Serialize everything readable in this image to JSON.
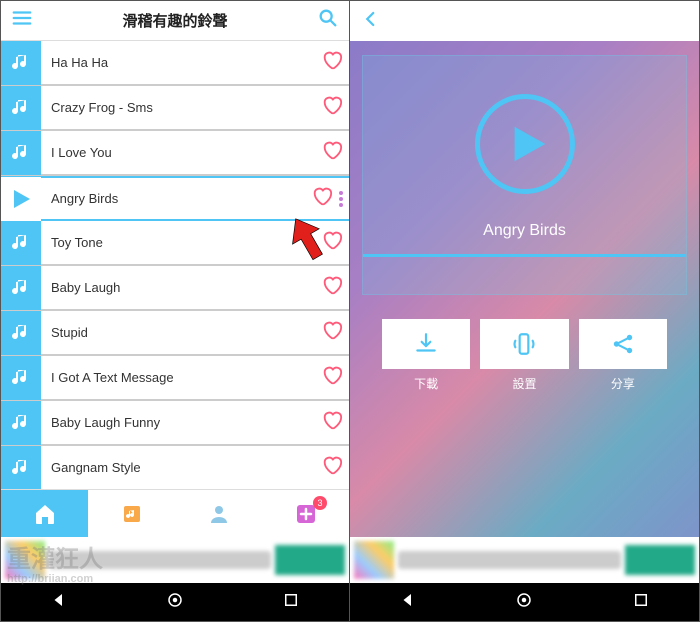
{
  "left": {
    "title": "滑稽有趣的鈴聲",
    "items": [
      {
        "label": "Ha Ha Ha"
      },
      {
        "label": "Crazy Frog - Sms"
      },
      {
        "label": "I Love You"
      },
      {
        "label": "Angry Birds",
        "selected": true
      },
      {
        "label": "Toy Tone"
      },
      {
        "label": "Baby Laugh"
      },
      {
        "label": "Stupid"
      },
      {
        "label": "I Got A Text Message"
      },
      {
        "label": "Baby Laugh Funny"
      },
      {
        "label": "Gangnam Style"
      }
    ],
    "nav_badge": "3"
  },
  "right": {
    "track": "Angry Birds",
    "actions": {
      "download": "下載",
      "set": "設置",
      "share": "分享"
    }
  },
  "watermark": {
    "line1": "重灌狂人",
    "line2": "http://briian.com"
  },
  "colors": {
    "accent": "#4ec5f4",
    "heart": "#ff5a7a",
    "arrow": "#e1201c"
  }
}
